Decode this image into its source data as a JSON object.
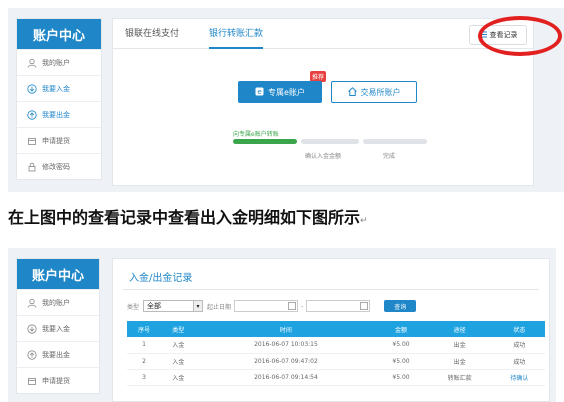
{
  "sidebar": {
    "title": "账户中心",
    "items": [
      {
        "label": "我的账户",
        "icon": "user-icon",
        "active": false
      },
      {
        "label": "我要入金",
        "icon": "deposit-icon",
        "active": true
      },
      {
        "label": "我要出金",
        "icon": "withdraw-icon",
        "active": true
      },
      {
        "label": "申请提货",
        "icon": "pickup-icon",
        "active": false
      },
      {
        "label": "修改密码",
        "icon": "lock-icon",
        "active": false
      }
    ]
  },
  "top_panel": {
    "tabs": [
      {
        "label": "银联在线支付",
        "active": false
      },
      {
        "label": "银行转账汇款",
        "active": true
      }
    ],
    "view_records": "查看记录",
    "recommend_badge": "推荐",
    "primary_button": "专属e账户",
    "secondary_button": "交易所账户",
    "steps": {
      "title": "向专属e账户转账",
      "labels": [
        "确认入金金额",
        "完成"
      ]
    }
  },
  "caption": {
    "text": "在上图中的查看记录中查看出入金明细如下图所示",
    "mark": "↵"
  },
  "bottom_panel": {
    "sidebar": {
      "title": "账户中心",
      "items": [
        {
          "label": "我的账户",
          "icon": "user-icon"
        },
        {
          "label": "我要入金",
          "icon": "deposit-icon"
        },
        {
          "label": "我要出金",
          "icon": "withdraw-icon"
        },
        {
          "label": "申请提货",
          "icon": "pickup-icon"
        }
      ]
    },
    "title": "入金/出金记录",
    "filter": {
      "type_label": "类型",
      "type_value": "全部",
      "date_label": "起止日期",
      "date_sep": "-",
      "query_button": "查询"
    },
    "table": {
      "headers": [
        "序号",
        "类型",
        "时间",
        "金额",
        "途径",
        "状态"
      ],
      "rows": [
        [
          "1",
          "入金",
          "2016-06-07 10:03:15",
          "¥5.00",
          "出金",
          "成功"
        ],
        [
          "2",
          "入金",
          "2016-06-07 09:47:02",
          "¥5.00",
          "出金",
          "成功"
        ],
        [
          "3",
          "入金",
          "2016-06-07 09:14:54",
          "¥5.00",
          "转账汇款",
          "待确认"
        ]
      ]
    }
  },
  "colors": {
    "brand_blue": "#1f86c8",
    "highlight_red": "#e32020",
    "step_green": "#3aa54a"
  }
}
